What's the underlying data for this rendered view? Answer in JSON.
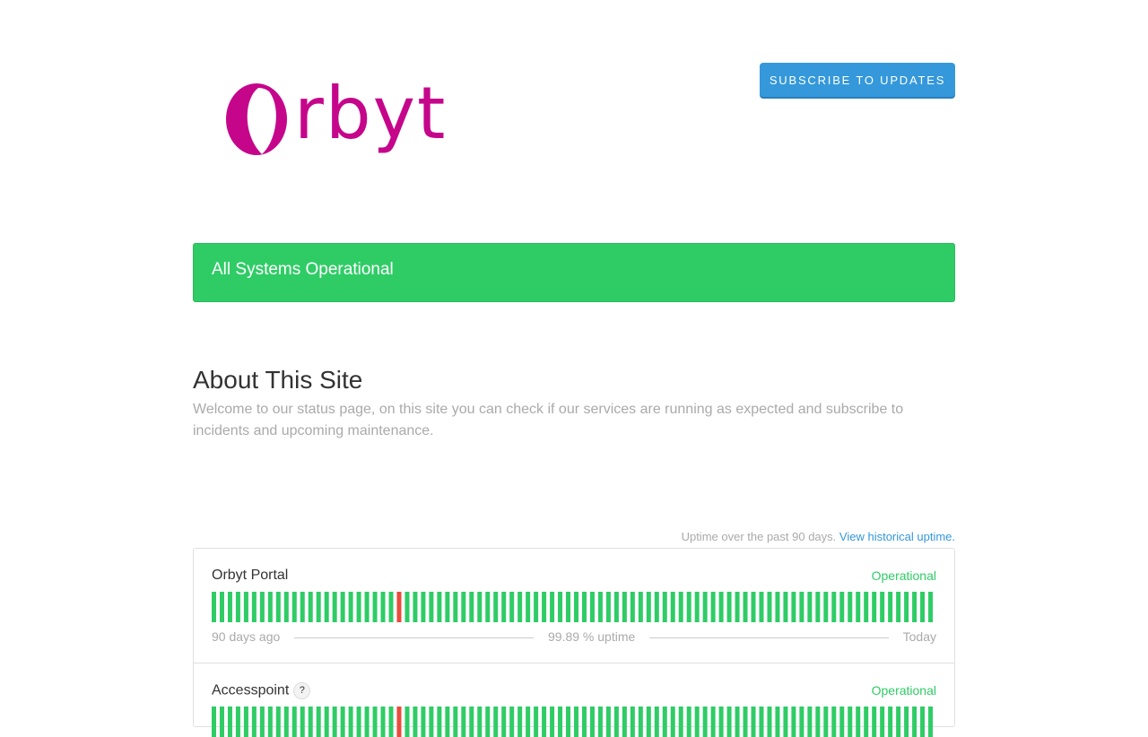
{
  "header": {
    "logo_text": "orbyt",
    "subscribe_label": "SUBSCRIBE TO UPDATES"
  },
  "banner": {
    "text": "All Systems Operational"
  },
  "about": {
    "title": "About This Site",
    "text": "Welcome to our status page, on this site you can check if our services are running as expected and subscribe to incidents and upcoming maintenance."
  },
  "uptime": {
    "caption": "Uptime over the past 90 days.",
    "link": "View historical uptime."
  },
  "components": [
    {
      "name": "Orbyt Portal",
      "status": "Operational",
      "has_help": false,
      "days_ago_label": "90 days ago",
      "uptime_label": "99.89 % uptime",
      "today_label": "Today",
      "days": 90,
      "outage_days": [
        23
      ]
    },
    {
      "name": "Accesspoint",
      "status": "Operational",
      "has_help": true,
      "help_icon": "?",
      "days": 90,
      "outage_days": [
        23
      ]
    }
  ],
  "colors": {
    "brand": "#c5068b",
    "operational": "#2fcc66",
    "outage": "#e74c3c",
    "link": "#3498db"
  }
}
